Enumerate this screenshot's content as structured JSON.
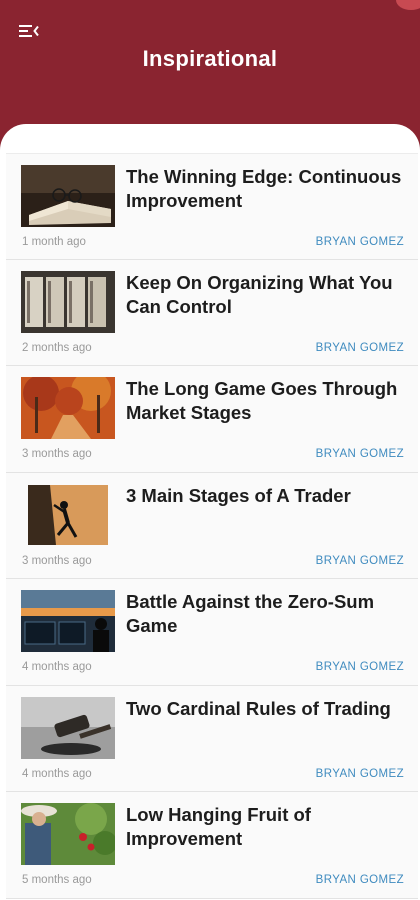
{
  "header": {
    "title": "Inspirational",
    "menu_icon": "menu-open-icon",
    "background_color": "#8a2430"
  },
  "articles": [
    {
      "title": "The Winning Edge: Continuous Improvement",
      "date": "1 month ago",
      "author": "BRYAN GOMEZ",
      "thumbnail": "open-book-with-glasses"
    },
    {
      "title": "Keep On Organizing What You Can Control",
      "date": "2 months ago",
      "author": "BRYAN GOMEZ",
      "thumbnail": "file-cabinet-folders"
    },
    {
      "title": "The Long Game Goes Through Market Stages",
      "date": "3 months ago",
      "author": "BRYAN GOMEZ",
      "thumbnail": "autumn-forest-path"
    },
    {
      "title": "3 Main Stages of A Trader",
      "date": "3 months ago",
      "author": "BRYAN GOMEZ",
      "thumbnail": "rock-climber-silhouette"
    },
    {
      "title": "Battle Against the Zero-Sum Game",
      "date": "4 months ago",
      "author": "BRYAN GOMEZ",
      "thumbnail": "trader-at-screens-sunset"
    },
    {
      "title": "Two Cardinal Rules of Trading",
      "date": "4 months ago",
      "author": "BRYAN GOMEZ",
      "thumbnail": "gavel"
    },
    {
      "title": "Low Hanging Fruit of Improvement",
      "date": "5 months ago",
      "author": "BRYAN GOMEZ",
      "thumbnail": "picking-fruit"
    }
  ]
}
